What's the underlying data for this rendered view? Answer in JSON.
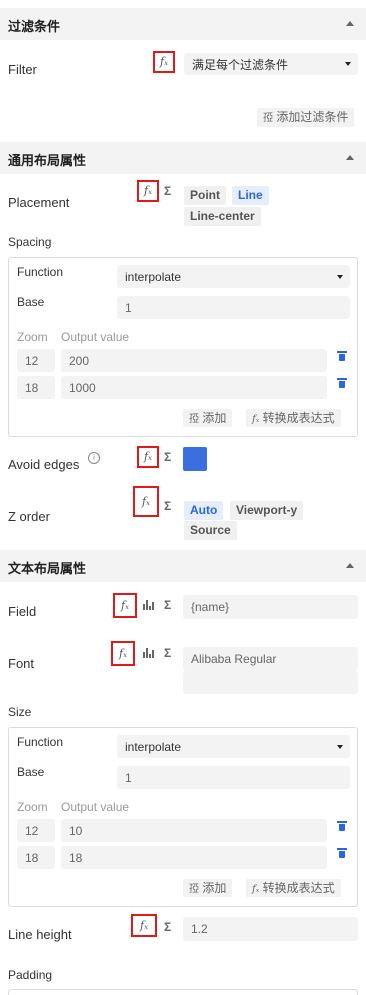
{
  "filter_section": {
    "title": "过滤条件",
    "filter_label": "Filter",
    "fx_icon": "fx-icon",
    "select_value": "满足每个过滤条件",
    "add_button": "添加过滤条件"
  },
  "layout_section": {
    "title": "通用布局属性",
    "placement": {
      "label": "Placement",
      "options": [
        "Point",
        "Line",
        "Line-center"
      ],
      "selected": "Line"
    },
    "spacing": {
      "label": "Spacing",
      "function_label": "Function",
      "function_value": "interpolate",
      "base_label": "Base",
      "base_value": "1",
      "zoom_header": "Zoom",
      "output_header": "Output value",
      "stops": [
        {
          "zoom": "12",
          "value": "200"
        },
        {
          "zoom": "18",
          "value": "1000"
        }
      ],
      "add_button": "添加",
      "convert_button": "转换成表达式"
    },
    "avoid_edges": {
      "label": "Avoid edges",
      "color": "#3b6fe0"
    },
    "z_order": {
      "label": "Z order",
      "options": [
        "Auto",
        "Viewport-y",
        "Source"
      ],
      "selected": "Auto"
    }
  },
  "text_section": {
    "title": "文本布局属性",
    "field": {
      "label": "Field",
      "value": "{name}"
    },
    "font": {
      "label": "Font",
      "value": "Alibaba Regular"
    },
    "size": {
      "label": "Size",
      "function_label": "Function",
      "function_value": "interpolate",
      "base_label": "Base",
      "base_value": "1",
      "zoom_header": "Zoom",
      "output_header": "Output value",
      "stops": [
        {
          "zoom": "12",
          "value": "10"
        },
        {
          "zoom": "18",
          "value": "18"
        }
      ],
      "add_button": "添加",
      "convert_button": "转换成表达式"
    },
    "line_height": {
      "label": "Line height",
      "value": "1.2"
    },
    "padding": {
      "label": "Padding"
    }
  },
  "glyphs": {
    "fx": "fₓ",
    "sigma": "Σ",
    "info": "i"
  },
  "colors": {
    "accent": "#2b66e0",
    "highlight_box": "#e01919",
    "section_bg": "#f3f3f3"
  }
}
